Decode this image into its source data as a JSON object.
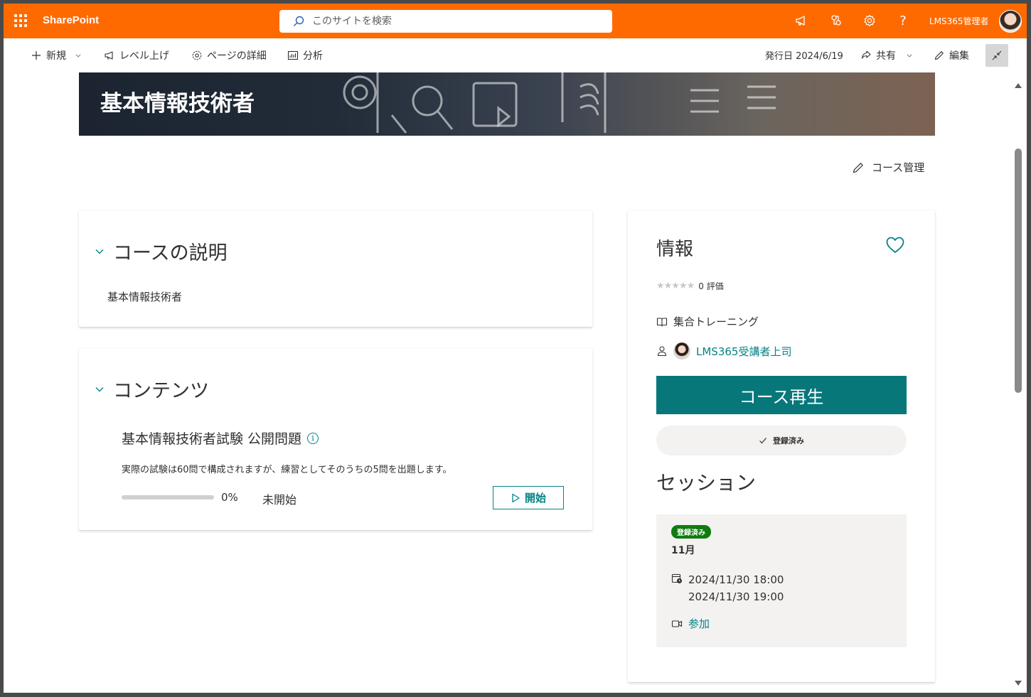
{
  "suite_bar": {
    "app_name": "SharePoint",
    "search_placeholder": "このサイトを検索",
    "user_name": "LMS365管理者",
    "colors": {
      "bar": "#ff6a00"
    },
    "icons": [
      "app-launcher-icon",
      "megaphone-icon",
      "share-network-icon",
      "settings-icon",
      "help-icon"
    ]
  },
  "command_bar": {
    "new_label": "新規",
    "promote_label": "レベル上げ",
    "page_details_label": "ページの詳細",
    "analytics_label": "分析",
    "published": "発行日 2024/6/19",
    "share_label": "共有",
    "edit_label": "編集"
  },
  "banner": {
    "title": "基本情報技術者"
  },
  "course_admin_label": "コース管理",
  "description_section": {
    "heading": "コースの説明",
    "text": "基本情報技術者"
  },
  "contents_section": {
    "heading": "コンテンツ",
    "item": {
      "title": "基本情報技術者試験 公開問題",
      "description": "実際の試験は60問で構成されますが、練習としてそのうちの5問を出題します。",
      "progress_percent": 0,
      "progress_text": "0%",
      "status": "未開始",
      "start_label": "開始"
    }
  },
  "info_card": {
    "heading": "情報",
    "rating_stars": 0,
    "rating_text": "0 評価",
    "training_type": "集合トレーニング",
    "instructor": "LMS365受講者上司",
    "play_label": "コース再生",
    "enrolled_label": "登録済み",
    "session_heading": "セッション",
    "session": {
      "badge": "登録済み",
      "month": "11月",
      "start": "2024/11/30 18:00",
      "end": "2024/11/30 19:00",
      "join_label": "参加"
    },
    "colors": {
      "accent": "#038387",
      "play_button": "#07777a",
      "badge": "#107c10"
    }
  }
}
